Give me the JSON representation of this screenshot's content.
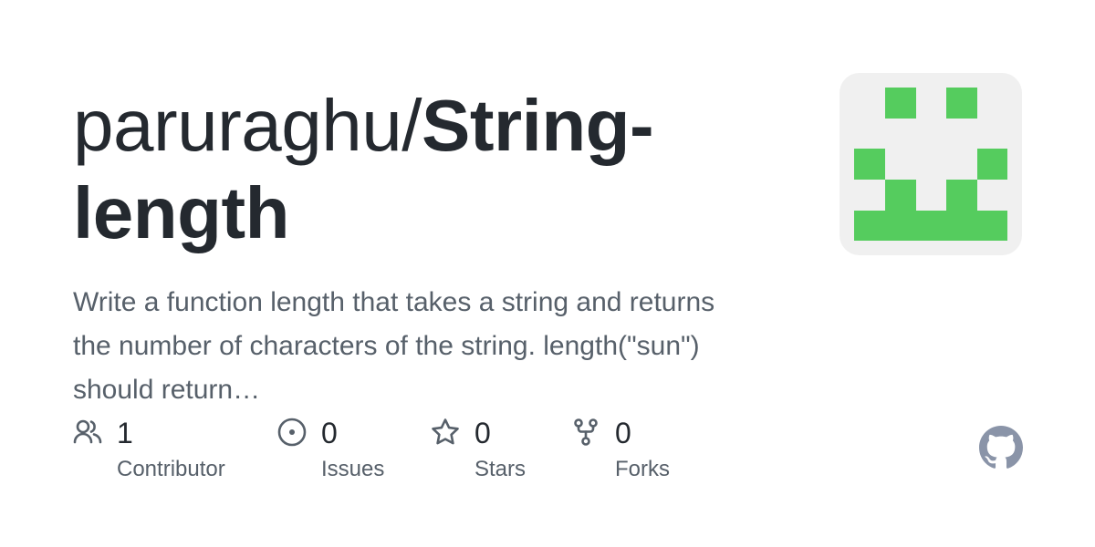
{
  "repo": {
    "owner_prefix": "paruraghu/",
    "name": "String-length",
    "description": "Write a function length that takes a string and returns the number of characters of the string. length(\"sun\") should return…"
  },
  "stats": [
    {
      "icon": "people-icon",
      "count": "1",
      "label": "Contributor"
    },
    {
      "icon": "issue-opened-icon",
      "count": "0",
      "label": "Issues"
    },
    {
      "icon": "star-icon",
      "count": "0",
      "label": "Stars"
    },
    {
      "icon": "repo-forked-icon",
      "count": "0",
      "label": "Forks"
    }
  ],
  "colors": {
    "text": "#24292f",
    "muted": "#57606a",
    "avatar_bg": "#f0f0f0",
    "avatar_fg": "#55cc5e",
    "github_mark": "#8a94a8"
  },
  "brand_icon": "github-mark-icon"
}
